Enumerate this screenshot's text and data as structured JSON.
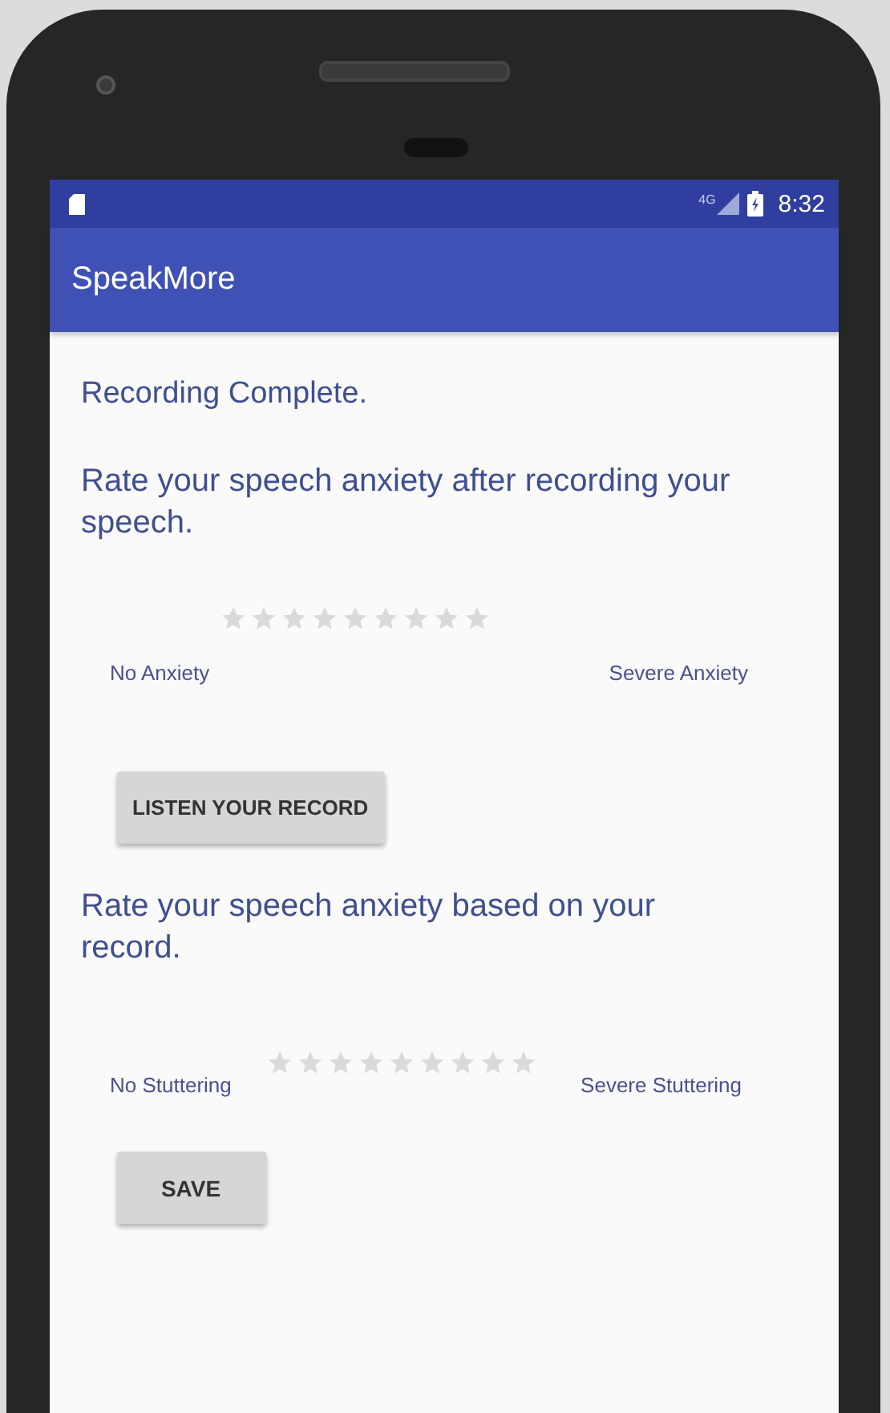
{
  "status_bar": {
    "network": "4G",
    "time": "8:32"
  },
  "app_bar": {
    "title": "SpeakMore"
  },
  "content": {
    "status": "Recording Complete.",
    "sections": [
      {
        "prompt": "Rate your speech anxiety after recording your speech.",
        "rating": {
          "stars": 0
        },
        "low_label": "No Anxiety",
        "high_label": "Severe Anxiety",
        "button": "LISTEN YOUR RECORD"
      },
      {
        "prompt": "Rate your speech anxiety based on your record.",
        "rating": {
          "stars": 0
        },
        "low_label": "No Stuttering",
        "high_label": "Severe Stuttering",
        "button": "SAVE"
      }
    ]
  }
}
